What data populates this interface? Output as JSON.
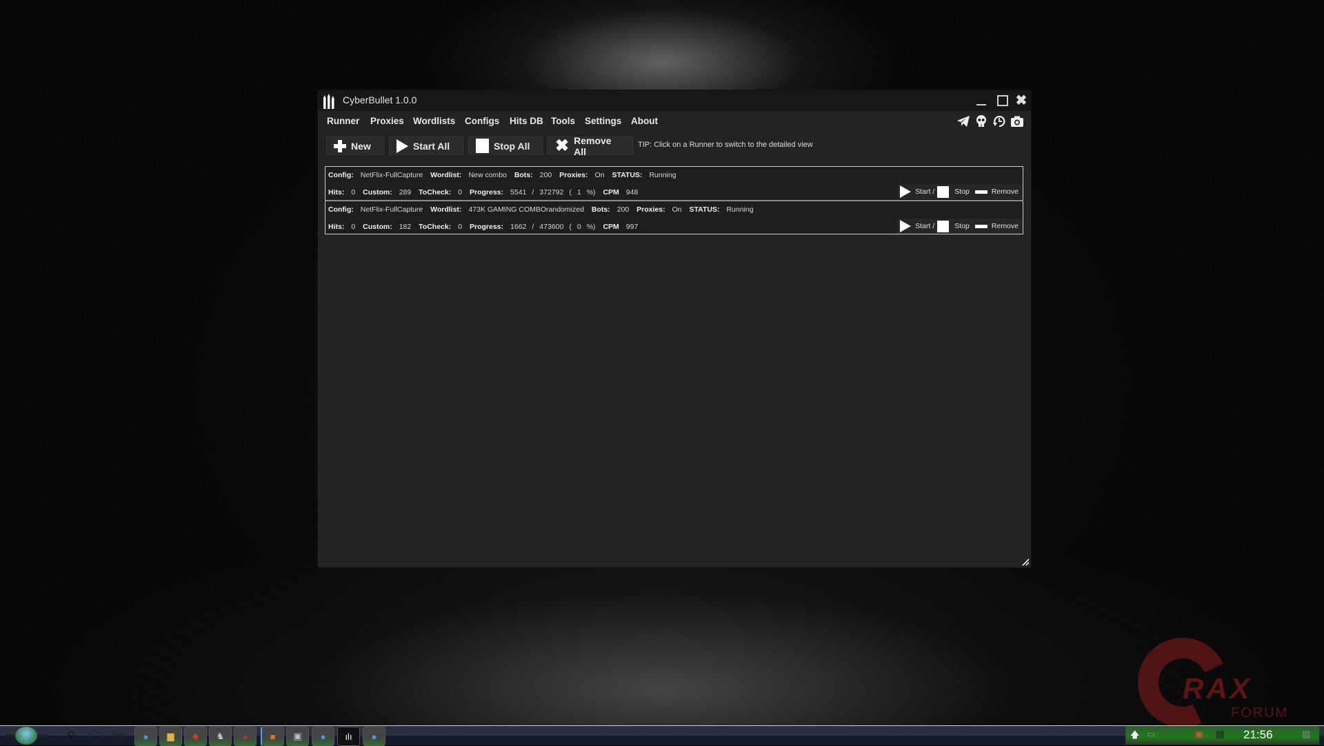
{
  "window": {
    "title": "CyberBullet 1.0.0",
    "controls": {
      "minimize": "minimize",
      "maximize": "maximize",
      "close": "✖"
    }
  },
  "menu": {
    "items": [
      "Runner",
      "Proxies",
      "Wordlists",
      "Configs",
      "Hits DB",
      "Tools",
      "Settings",
      "About"
    ],
    "icons": [
      "telegram-icon",
      "skull-icon",
      "history-icon",
      "camera-icon"
    ]
  },
  "toolbar": {
    "new_label": "New",
    "start_all_label": "Start All",
    "stop_all_label": "Stop All",
    "remove_all_label": "Remove All",
    "tip": "TIP: Click on a Runner to switch to the detailed view"
  },
  "labels": {
    "config": "Config:",
    "wordlist": "Wordlist:",
    "bots": "Bots:",
    "proxies": "Proxies:",
    "status": "STATUS:",
    "hits": "Hits:",
    "custom": "Custom:",
    "tocheck": "ToCheck:",
    "progress": "Progress:",
    "cpm": "CPM",
    "start": "Start /",
    "stop": "Stop",
    "remove": "Remove"
  },
  "runners": [
    {
      "config": "NetFlix-FullCapture",
      "wordlist": "New combo",
      "bots": "200",
      "proxies": "On",
      "status": "Running",
      "hits": "0",
      "custom": "289",
      "tocheck": "0",
      "progress_done": "5541",
      "progress_total": "372792",
      "progress_pct": "1",
      "cpm": "948"
    },
    {
      "config": "NetFlix-FullCapture",
      "wordlist": "473K GAMING COMBOrandomized",
      "bots": "200",
      "proxies": "On",
      "status": "Running",
      "hits": "0",
      "custom": "182",
      "tocheck": "0",
      "progress_done": "1662",
      "progress_total": "473600",
      "progress_pct": "0",
      "cpm": "997"
    }
  ],
  "taskbar": {
    "clock": "21:56",
    "apps": [
      "edge",
      "file-explorer",
      "app-red",
      "app-robot",
      "app-red-circle",
      "app-orange",
      "app-search-tool",
      "telegram",
      "cyberbullet",
      "app-blue-globe"
    ]
  },
  "watermark": {
    "text": "RAX",
    "sub": "FORUM"
  }
}
